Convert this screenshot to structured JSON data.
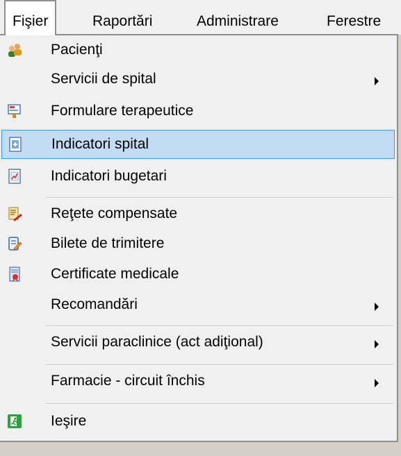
{
  "menubar": {
    "items": [
      {
        "label": "Fişier",
        "active": true
      },
      {
        "label": "Raportări"
      },
      {
        "label": "Administrare"
      },
      {
        "label": "Ferestre"
      }
    ]
  },
  "menu": {
    "items": [
      {
        "label": "Pacienţi",
        "icon": "patients-icon"
      },
      {
        "label": "Servicii de spital",
        "submenu": true
      },
      {
        "label": "Formulare terapeutice",
        "icon": "therapeutic-forms-icon"
      },
      {
        "label": "Indicatori spital",
        "icon": "hospital-indicators-icon",
        "highlighted": true
      },
      {
        "label": "Indicatori bugetari",
        "icon": "budget-indicators-icon"
      },
      {
        "label": "Reţete compensate",
        "icon": "prescriptions-icon"
      },
      {
        "label": "Bilete de trimitere",
        "icon": "referrals-icon"
      },
      {
        "label": "Certificate medicale",
        "icon": "medical-certificates-icon"
      },
      {
        "label": "Recomandări",
        "submenu": true
      },
      {
        "label": "Servicii paraclinice (act adiţional)",
        "submenu": true
      },
      {
        "label": "Farmacie - circuit închis",
        "submenu": true
      },
      {
        "label": "Ieşire",
        "icon": "exit-icon"
      }
    ]
  },
  "colors": {
    "highlight_bg": "#c4dcf3",
    "highlight_border": "#3399ff",
    "menu_bg": "#f0f0f0"
  }
}
